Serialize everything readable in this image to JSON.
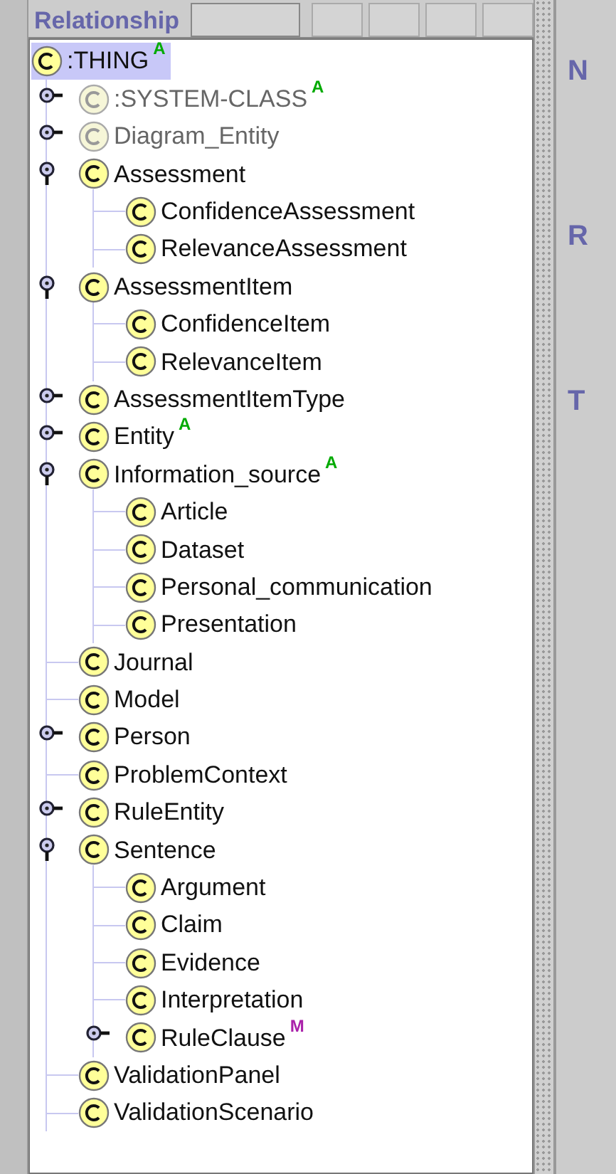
{
  "toolbar": {
    "title": "Relationship"
  },
  "tree": [
    {
      "label": ":THING",
      "selected": true,
      "abstract": false,
      "badge": {
        "text": "A",
        "color": "#00aa00"
      },
      "children": [
        {
          "label": ":SYSTEM-CLASS",
          "selected": false,
          "abstract": true,
          "badge": {
            "text": "A",
            "color": "#00aa00"
          },
          "expanded": false
        },
        {
          "label": "Diagram_Entity",
          "selected": false,
          "abstract": true,
          "expanded": false
        },
        {
          "label": "Assessment",
          "selected": false,
          "abstract": false,
          "expanded": true,
          "children": [
            {
              "label": "ConfidenceAssessment",
              "selected": false,
              "abstract": false
            },
            {
              "label": "RelevanceAssessment",
              "selected": false,
              "abstract": false
            }
          ]
        },
        {
          "label": "AssessmentItem",
          "selected": false,
          "abstract": false,
          "expanded": true,
          "children": [
            {
              "label": "ConfidenceItem",
              "selected": false,
              "abstract": false
            },
            {
              "label": "RelevanceItem",
              "selected": false,
              "abstract": false
            }
          ]
        },
        {
          "label": "AssessmentItemType",
          "selected": false,
          "abstract": false,
          "expanded": false
        },
        {
          "label": "Entity",
          "selected": false,
          "abstract": false,
          "badge": {
            "text": "A",
            "color": "#00aa00"
          },
          "expanded": false
        },
        {
          "label": "Information_source",
          "selected": false,
          "abstract": false,
          "badge": {
            "text": "A",
            "color": "#00aa00"
          },
          "expanded": true,
          "children": [
            {
              "label": "Article",
              "selected": false,
              "abstract": false
            },
            {
              "label": "Dataset",
              "selected": false,
              "abstract": false
            },
            {
              "label": "Personal_communication",
              "selected": false,
              "abstract": false
            },
            {
              "label": "Presentation",
              "selected": false,
              "abstract": false
            }
          ]
        },
        {
          "label": "Journal",
          "selected": false,
          "abstract": false
        },
        {
          "label": "Model",
          "selected": false,
          "abstract": false
        },
        {
          "label": "Person",
          "selected": false,
          "abstract": false,
          "expanded": false
        },
        {
          "label": "ProblemContext",
          "selected": false,
          "abstract": false
        },
        {
          "label": "RuleEntity",
          "selected": false,
          "abstract": false,
          "expanded": false
        },
        {
          "label": "Sentence",
          "selected": false,
          "abstract": false,
          "expanded": true,
          "children": [
            {
              "label": "Argument",
              "selected": false,
              "abstract": false
            },
            {
              "label": "Claim",
              "selected": false,
              "abstract": false
            },
            {
              "label": "Evidence",
              "selected": false,
              "abstract": false
            },
            {
              "label": "Interpretation",
              "selected": false,
              "abstract": false
            },
            {
              "label": "RuleClause",
              "selected": false,
              "abstract": false,
              "badge": {
                "text": "M",
                "color": "#aa22aa"
              },
              "expanded": false
            }
          ]
        },
        {
          "label": "ValidationPanel",
          "selected": false,
          "abstract": false
        },
        {
          "label": "ValidationScenario",
          "selected": false,
          "abstract": false
        }
      ]
    }
  ],
  "side_panel": {
    "labels": [
      "N",
      "R",
      "T"
    ]
  }
}
